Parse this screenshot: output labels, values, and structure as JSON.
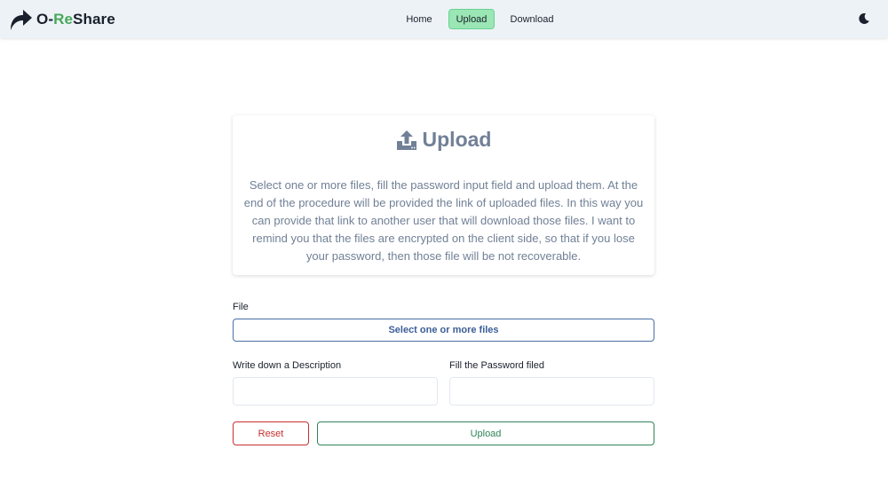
{
  "navbar": {
    "brand": {
      "prefix": "O-",
      "accent": "Re",
      "suffix": "Share",
      "icon": "share-arrow-icon"
    },
    "links": [
      {
        "label": "Home",
        "active": false
      },
      {
        "label": "Upload",
        "active": true
      },
      {
        "label": "Download",
        "active": false
      }
    ],
    "theme_toggle_icon": "moon-icon"
  },
  "intro": {
    "icon": "upload-icon",
    "title": "Upload",
    "text": "Select one or more files, fill the password input field and upload them. At the end of the procedure will be provided the link of uploaded files. In this way you can provide that link to another user that will download those files. I want to remind you that the files are encrypted on the client side, so that if you lose your password, then those file will be not recoverable."
  },
  "form": {
    "file_label": "File",
    "file_button": "Select one or more files",
    "description_label": "Write down a Description",
    "description_value": "",
    "password_label": "Fill the Password filed",
    "password_value": "",
    "reset_button": "Reset",
    "upload_button": "Upload"
  },
  "colors": {
    "accent_green": "#48a85a",
    "active_nav": "#9ae6b4",
    "reset_red": "#c53030",
    "upload_green": "#2f855a",
    "file_blue": "#3b5e98"
  }
}
